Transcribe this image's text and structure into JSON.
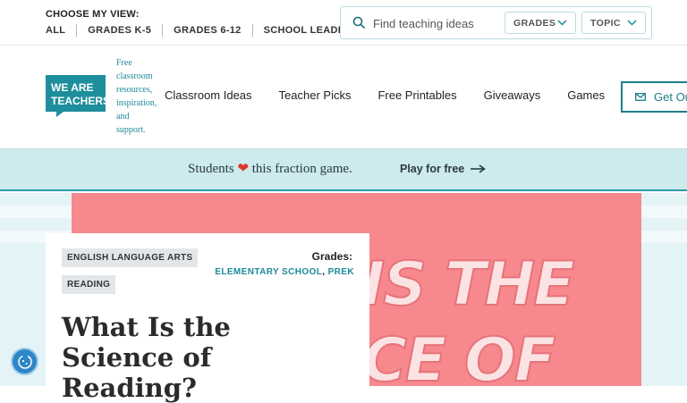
{
  "utility": {
    "choose_label": "CHOOSE MY VIEW:",
    "views": [
      "ALL",
      "GRADES K-5",
      "GRADES 6-12",
      "SCHOOL LEADERS"
    ],
    "search_placeholder": "Find teaching ideas",
    "dropdowns": {
      "grades": "GRADES",
      "topic": "TOPIC"
    }
  },
  "header": {
    "logo_text": [
      "WE ARE",
      "TEACHERS"
    ],
    "tagline": [
      "Free",
      "classroom",
      "resources,",
      "inspiration,",
      "and",
      "support."
    ],
    "nav": [
      "Classroom Ideas",
      "Teacher Picks",
      "Free Printables",
      "Giveaways",
      "Games"
    ],
    "cta": "Get Ou"
  },
  "promo": {
    "text_before": "Students",
    "text_after": "this fraction game.",
    "link": "Play for free"
  },
  "article": {
    "tags": [
      "ENGLISH LANGUAGE ARTS",
      "READING"
    ],
    "grades_label": "Grades:",
    "grades": [
      "ELEMENTARY SCHOOL",
      "PREK"
    ],
    "title": "What Is the Science of Reading?",
    "hero_lines": [
      "IS THE",
      "CE OF"
    ]
  },
  "colors": {
    "teal": "#1c8a99",
    "hero_pink": "#f6888e",
    "banner": "#cdeaec",
    "heart": "#e0342d"
  }
}
